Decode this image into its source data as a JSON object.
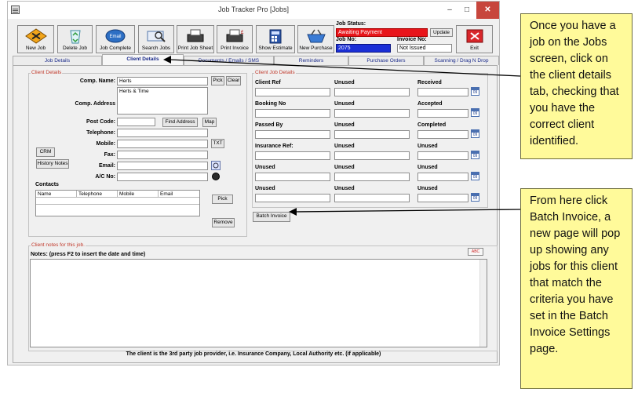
{
  "window": {
    "title": "Job Tracker Pro [Jobs]",
    "minimize": "–",
    "maximize": "□",
    "close": "✕"
  },
  "toolbar": {
    "new_job": "New Job",
    "delete_job": "Delete Job",
    "job_complete": "Job Complete",
    "search_jobs": "Search Jobs",
    "print_job_sheet": "Print Job Sheet",
    "print_invoice": "Print Invoice",
    "show_estimate": "Show Estimate",
    "new_purchase": "New Purchase",
    "exit": "Exit"
  },
  "status": {
    "job_status_label": "Job Status:",
    "job_status_value": "Awaiting Payment",
    "update_label": "Update",
    "job_no_label": "Job No:",
    "job_no_value": "2075",
    "invoice_no_label": "Invoice No:",
    "invoice_no_value": "Not Issued"
  },
  "tabs": [
    {
      "label": "Job Details"
    },
    {
      "label": "Client Details"
    },
    {
      "label": "Documents / Emails / SMS"
    },
    {
      "label": "Reminders"
    },
    {
      "label": "Purchase Orders"
    },
    {
      "label": "Scanning / Drag N Drop"
    }
  ],
  "client_details": {
    "group_title": "Client Details",
    "comp_name_label": "Comp. Name:",
    "comp_name_value": "Herts",
    "pick_label": "Pick",
    "clear_label": "Clear",
    "comp_address_label": "Comp. Address",
    "comp_address_value": "Herts & Time",
    "post_code_label": "Post Code:",
    "post_code_value": "",
    "find_address_label": "Find Address",
    "map_label": "Map",
    "telephone_label": "Telephone:",
    "mobile_label": "Mobile:",
    "txt_label": "TXT",
    "fax_label": "Fax:",
    "email_label": "Email:",
    "ac_no_label": "A/C No:",
    "crm_label": "CRM",
    "history_notes_label": "History Notes",
    "contacts_label": "Contacts",
    "contacts_columns": [
      "Name",
      "Telephone",
      "Mobile",
      "Email"
    ],
    "contacts_pick_label": "Pick",
    "remove_label": "Remove"
  },
  "client_job_details": {
    "group_title": "Client Job Details",
    "rows": [
      [
        "Client Ref",
        "Unused",
        "Received"
      ],
      [
        "Booking No",
        "Unused",
        "Accepted"
      ],
      [
        "Passed By",
        "Unused",
        "Completed"
      ],
      [
        "Insurance Ref:",
        "Unused",
        "Unused"
      ],
      [
        "Unused",
        "Unused",
        "Unused"
      ],
      [
        "Unused",
        "Unused",
        "Unused"
      ]
    ],
    "calendar_icon_text": "09",
    "batch_invoice_label": "Batch Invoice"
  },
  "notes": {
    "group_title": "Client notes for this job.",
    "notes_label": "Notes: (press F2 to insert the date and time)",
    "spellcheck_label": "ABC"
  },
  "footer": "The client is the 3rd party job provider, i.e. Insurance Company, Local Authority etc. (if applicable)",
  "callouts": {
    "top": "Once you have a job on the Jobs screen, click on the client details tab, checking that you have the correct client identified.",
    "bottom": "From here click Batch Invoice, a new page will pop up showing any jobs for this client that match the criteria you have set in the Batch Invoice Settings page."
  },
  "colors": {
    "status_bg": "#e8151b",
    "job_no_bg": "#1b2fd6",
    "callout_bg": "#fffa9a",
    "group_title": "#c0392b"
  }
}
